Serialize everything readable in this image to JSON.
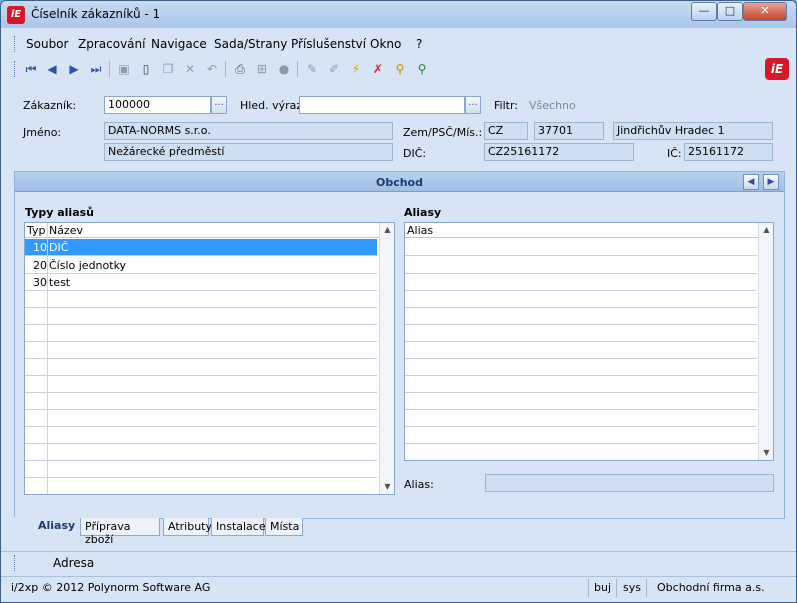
{
  "window": {
    "title": "Číselník zákazníků - 1",
    "app_icon_text": "iE",
    "btn_min": "—",
    "btn_max": "□",
    "btn_close": "✕"
  },
  "menu": [
    "Soubor",
    "Zpracování",
    "Navigace",
    "Sada/Strany",
    "Příslušenství",
    "Okno",
    "?"
  ],
  "toolbar": {
    "icons": [
      "first-icon",
      "prev-icon",
      "next-icon",
      "last-icon",
      "save-icon",
      "new-icon",
      "copy-icon",
      "delete-icon",
      "undo-icon",
      "print-icon",
      "tree-icon",
      "disabled-icon",
      "edit-icon",
      "pen-icon",
      "filter-icon",
      "clear-filter-icon",
      "search-icon",
      "search-next-icon"
    ],
    "brand_logo": "iE"
  },
  "form": {
    "zakaznik_label": "Zákazník:",
    "zakaznik_value": "100000",
    "hled_label": "Hled. výraz:",
    "hled_value": "",
    "filtr_label": "Filtr:",
    "filtr_value": "Všechno",
    "jmeno_label": "Jméno:",
    "jmeno1": "DATA-NORMS s.r.o.",
    "jmeno2": "Nežárecké předměstí",
    "zem_label": "Zem/PSČ/Mís.:",
    "zem": "CZ",
    "psc": "37701",
    "mesto": "Jindřichův Hradec 1",
    "dic_label": "DIČ:",
    "dic": "CZ25161172",
    "ic_label": "IČ:",
    "ic": "25161172",
    "dots": "..."
  },
  "panel": {
    "title": "Obchod",
    "typy_title": "Typy aliasů",
    "typy_headers": {
      "typ": "Typ",
      "nazev": "Název"
    },
    "typy_rows": [
      {
        "typ": "10",
        "nazev": "DIČ"
      },
      {
        "typ": "20",
        "nazev": "Číslo jednotky"
      },
      {
        "typ": "30",
        "nazev": "test"
      }
    ],
    "aliasy_title": "Aliasy",
    "aliasy_header": "Alias",
    "alias_label": "Alias:",
    "alias_value": ""
  },
  "tabs": [
    "Aliasy",
    "Příprava zboží",
    "Atributy",
    "Instalace",
    "Místa"
  ],
  "section_bar": {
    "label": "Adresa"
  },
  "status": {
    "copyright": "i/2xp © 2012 Polynorm Software AG",
    "user": "buj",
    "system": "sys",
    "company": "Obchodní firma a.s."
  }
}
